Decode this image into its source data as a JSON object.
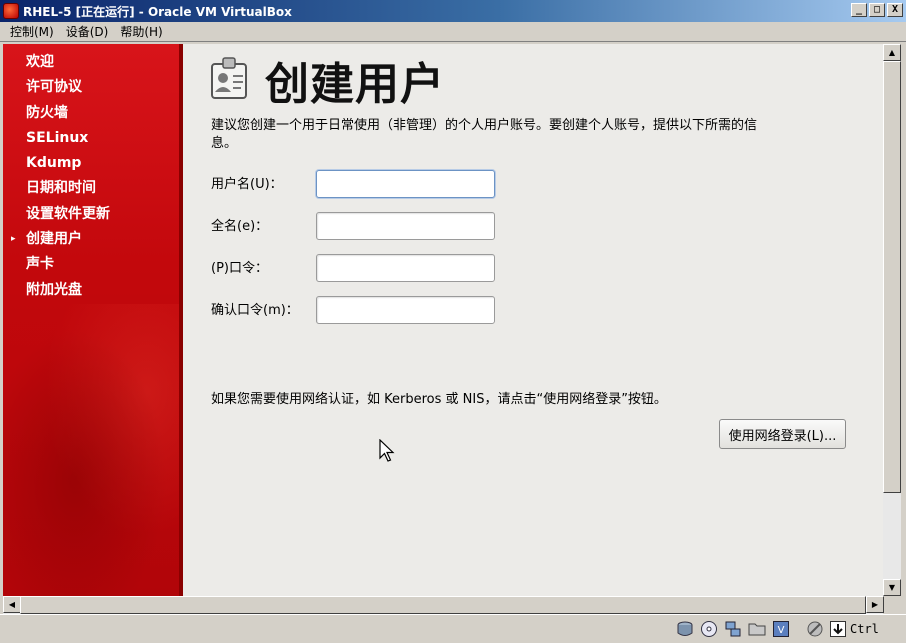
{
  "window": {
    "title": "RHEL-5 [正在运行] - Oracle VM VirtualBox"
  },
  "menubar": {
    "items": [
      "控制(M)",
      "设备(D)",
      "帮助(H)"
    ]
  },
  "sidebar": {
    "items": [
      {
        "label": "欢迎"
      },
      {
        "label": "许可协议"
      },
      {
        "label": "防火墙"
      },
      {
        "label": "SELinux"
      },
      {
        "label": "Kdump"
      },
      {
        "label": "日期和时间"
      },
      {
        "label": "设置软件更新"
      },
      {
        "label": "创建用户",
        "current": true
      },
      {
        "label": "声卡"
      },
      {
        "label": "附加光盘"
      }
    ],
    "current_marker": "▸"
  },
  "page": {
    "title": "创建用户",
    "intro": "建议您创建一个用于日常使用（非管理）的个人用户账号。要创建个人账号，提供以下所需的信息。",
    "fields": [
      {
        "label": "用户名(U)：",
        "value": ""
      },
      {
        "label": "全名(e)：",
        "value": ""
      },
      {
        "label": "(P)口令：",
        "value": ""
      },
      {
        "label": "确认口令(m)：",
        "value": ""
      }
    ],
    "network_note": "如果您需要使用网络认证，如 Kerberos 或 NIS，请点击“使用网络登录”按钮。",
    "network_button": "使用网络登录(L)..."
  },
  "statusbar": {
    "icons": [
      "hard-disk-icon",
      "cd-icon",
      "network-icon",
      "folder-icon",
      "vbox-icon",
      "mouse-integration-icon",
      "keyboard-capture-icon"
    ],
    "host_key": "Ctrl"
  },
  "colors": {
    "sidebar_red": "#c3080c",
    "content_bg": "#ecebe8",
    "title_bar": "#0a246a"
  }
}
